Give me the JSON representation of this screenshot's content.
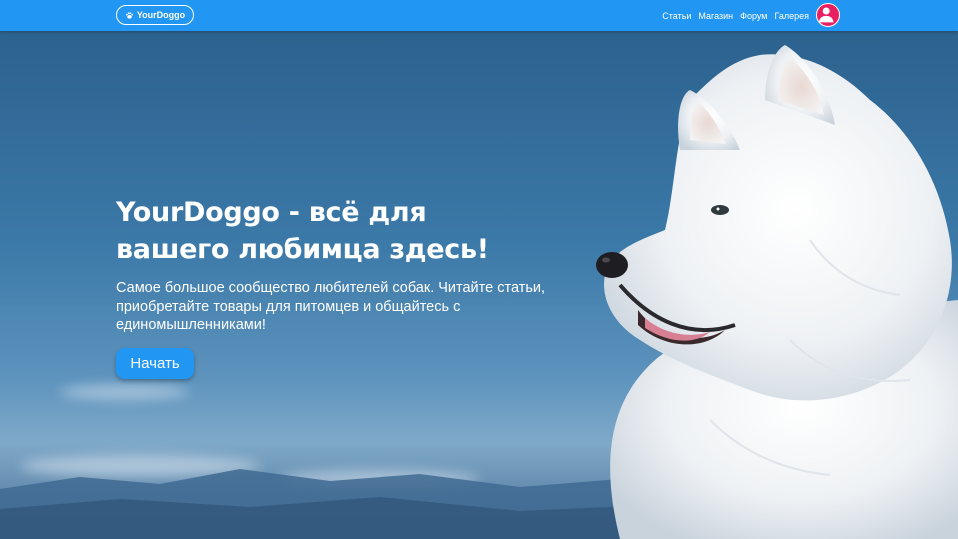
{
  "navbar": {
    "logo_text": "YourDoggo",
    "logo_icon": "paw-icon",
    "links": [
      {
        "label": "Статьи"
      },
      {
        "label": "Магазин"
      },
      {
        "label": "Форум"
      },
      {
        "label": "Галерея"
      }
    ],
    "avatar_icon": "user-avatar-icon",
    "bg_color": "#2196f3",
    "avatar_color": "#e91e63"
  },
  "hero": {
    "title": "YourDoggo - всё для вашего любимца здесь!",
    "subtitle": "Самое большое сообщество любителей собак. Читайте статьи, приобретайте товары для питомцев и общайтесь с единомышленниками!",
    "cta_label": "Начать",
    "background_image": "white-samoyed-dog-photo"
  }
}
